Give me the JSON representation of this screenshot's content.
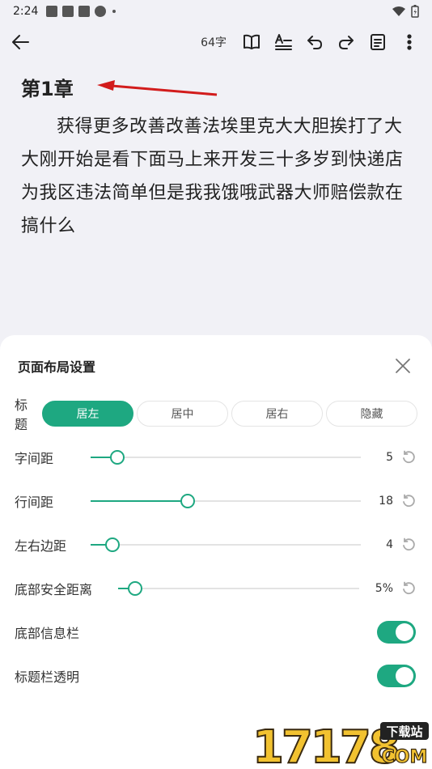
{
  "status_bar": {
    "time": "2:24"
  },
  "toolbar": {
    "word_count": "64字"
  },
  "reader": {
    "chapter_title": "第1章",
    "paragraph": "获得更多改善改善法埃里克大大胆挨打了大大刚开始是看下面马上来开发三十多岁到快递店为我区违法简单但是我我饿哦武器大师赔偿款在搞什么"
  },
  "layout_sheet": {
    "title": "页面布局设置",
    "title_row": {
      "label": "标题",
      "options": [
        "居左",
        "居中",
        "居右",
        "隐藏"
      ],
      "selected": "居左"
    },
    "sliders": [
      {
        "label": "字间距",
        "value": "5",
        "level": 0.1
      },
      {
        "label": "行间距",
        "value": "18",
        "level": 0.36
      },
      {
        "label": "左右边距",
        "value": "4",
        "level": 0.08
      },
      {
        "label": "底部安全距离",
        "value": "5%",
        "level": 0.07
      }
    ],
    "toggles": [
      {
        "label": "底部信息栏",
        "on": true
      },
      {
        "label": "标题栏透明",
        "on": true
      }
    ]
  },
  "watermark": {
    "text": "17178",
    "badge": "下载站",
    "suffix": "COM"
  },
  "colors": {
    "accent": "#1ea881",
    "arrow": "#d21c1c",
    "background": "#f1f1f6"
  }
}
